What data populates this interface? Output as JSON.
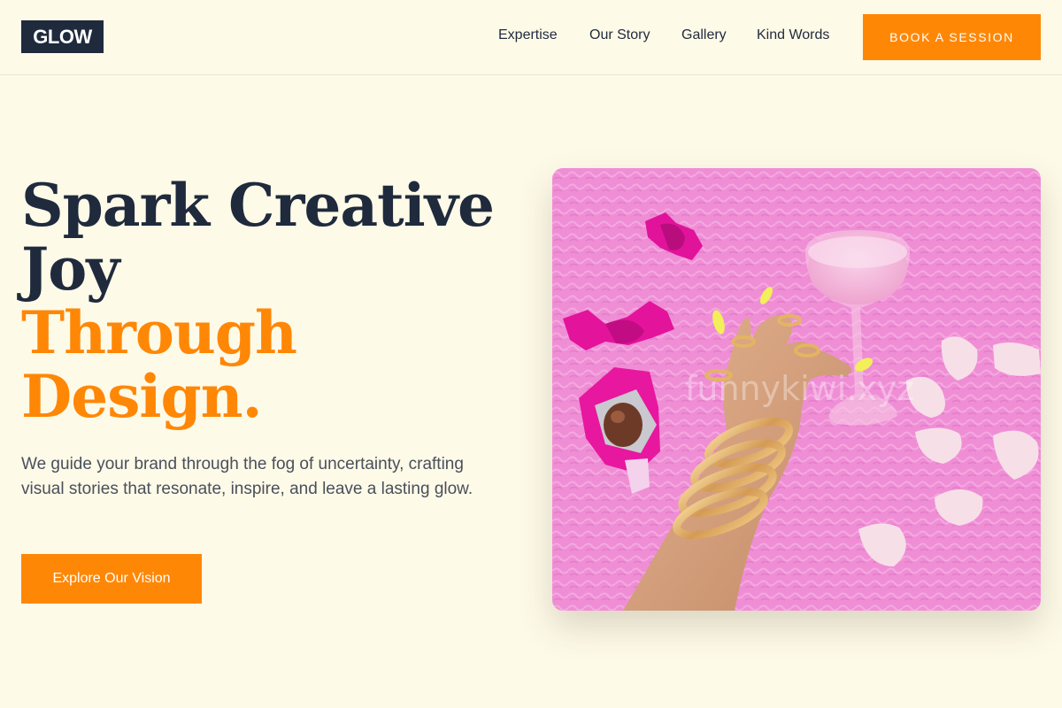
{
  "header": {
    "logo": "GLOW",
    "nav": [
      "Expertise",
      "Our Story",
      "Gallery",
      "Kind Words"
    ],
    "cta": "BOOK A SESSION"
  },
  "hero": {
    "title_line1": "Spark Creative",
    "title_line2": "Joy",
    "title_line3": "Through",
    "title_line4": "Design.",
    "subtitle": "We guide your brand through the fog of uncertainty, crafting visual stories that resonate, inspire, and leave a lasting glow.",
    "cta": "Explore Our Vision",
    "image_watermark": "funnykiwi.xyz"
  },
  "colors": {
    "background": "#fefae8",
    "navy": "#1f2a3d",
    "accent": "#ff8706",
    "photo_pink": "#ef8fd6"
  }
}
